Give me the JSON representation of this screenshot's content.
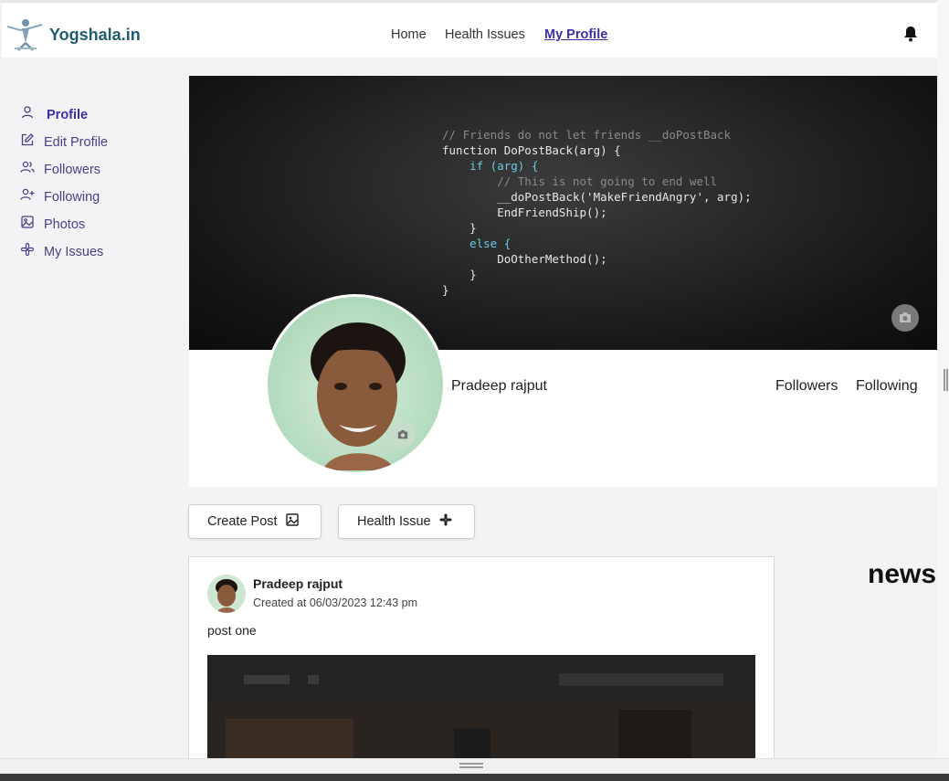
{
  "nav": {
    "brand": "Yogshala.in",
    "links": [
      "Home",
      "Health Issues",
      "My Profile"
    ],
    "active": "My Profile"
  },
  "sidebar": {
    "items": [
      {
        "label": "Profile",
        "icon": "user-icon",
        "active": true
      },
      {
        "label": "Edit Profile",
        "icon": "edit-icon",
        "active": false
      },
      {
        "label": "Followers",
        "icon": "users-icon",
        "active": false
      },
      {
        "label": "Following",
        "icon": "user-plus-icon",
        "active": false
      },
      {
        "label": "Photos",
        "icon": "image-icon",
        "active": false
      },
      {
        "label": "My Issues",
        "icon": "slack-icon",
        "active": false
      }
    ]
  },
  "cover": {
    "code_lines": [
      "// Friends do not let friends __doPostBack",
      "function DoPostBack(arg) {",
      "    if (arg) {",
      "        // This is not going to end well",
      "        __doPostBack('MakeFriendAngry', arg);",
      "        EndFriendShip();",
      "    }",
      "    else {",
      "        DoOtherMethod();",
      "    }",
      "}"
    ]
  },
  "profile": {
    "name": "Pradeep rajput",
    "followers_label": "Followers",
    "following_label": "Following"
  },
  "actions": {
    "create_post": "Create Post",
    "health_issue": "Health Issue"
  },
  "post": {
    "author": "Pradeep rajput",
    "created": "Created at 06/03/2023 12:43 pm",
    "text": "post one"
  },
  "news": {
    "heading": "news"
  },
  "colors": {
    "accent": "#3a2fa3",
    "sidebar_text": "#4b3e86",
    "brand": "#1f5c6e"
  }
}
